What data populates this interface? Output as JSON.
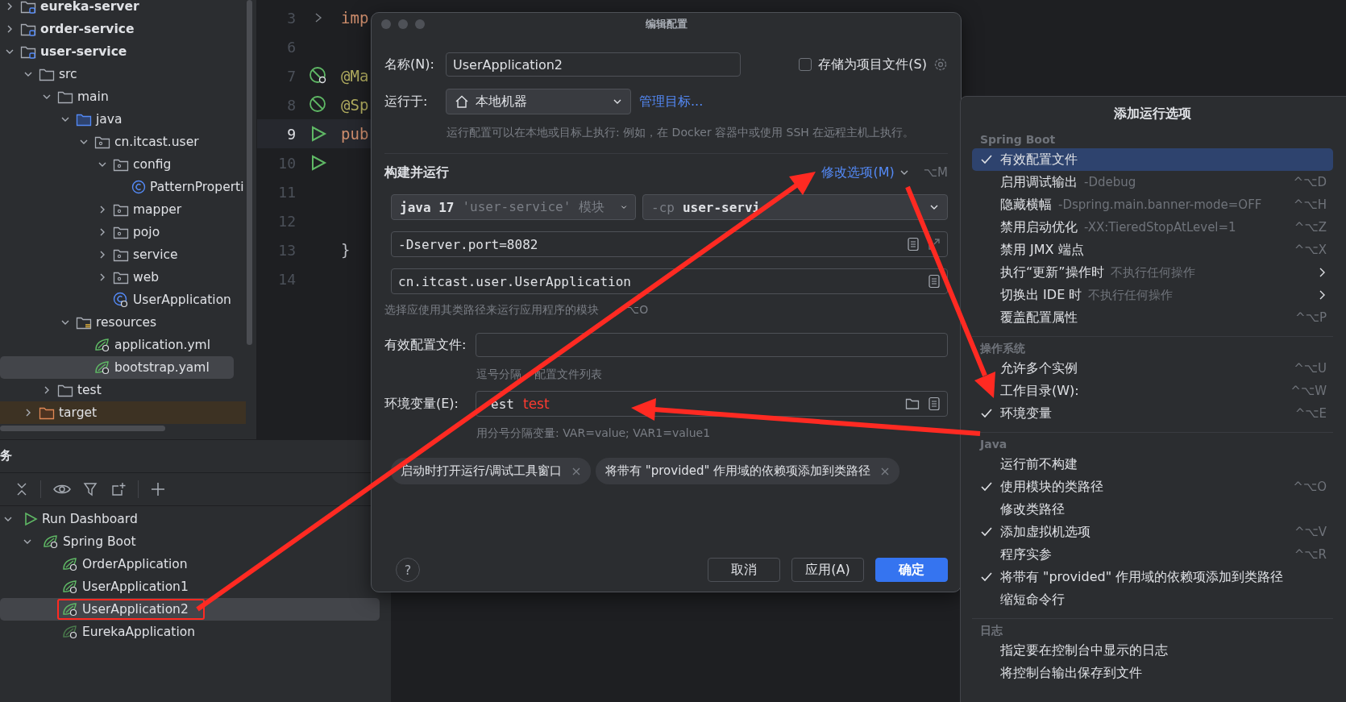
{
  "project_tree": {
    "items": [
      {
        "label": "eureka-server",
        "kind": "module",
        "expanded": false,
        "selected": false
      },
      {
        "label": "order-service",
        "kind": "module",
        "expanded": false,
        "selected": false
      },
      {
        "label": "user-service",
        "kind": "module",
        "expanded": true,
        "selected": false,
        "children": [
          {
            "label": "src",
            "kind": "folder",
            "expanded": true,
            "selected": false,
            "children": [
              {
                "label": "main",
                "kind": "folder",
                "expanded": true,
                "selected": false,
                "children": [
                  {
                    "label": "java",
                    "kind": "source-folder",
                    "expanded": true,
                    "selected": false,
                    "children": [
                      {
                        "label": "cn.itcast.user",
                        "kind": "package",
                        "expanded": true,
                        "selected": false,
                        "children": [
                          {
                            "label": "config",
                            "kind": "package",
                            "expanded": true,
                            "selected": false,
                            "children": [
                              {
                                "label": "PatternProperti",
                                "kind": "class",
                                "selected": false
                              }
                            ]
                          },
                          {
                            "label": "mapper",
                            "kind": "package",
                            "expanded": false,
                            "selected": false
                          },
                          {
                            "label": "pojo",
                            "kind": "package",
                            "expanded": false,
                            "selected": false
                          },
                          {
                            "label": "service",
                            "kind": "package",
                            "expanded": false,
                            "selected": false
                          },
                          {
                            "label": "web",
                            "kind": "package",
                            "expanded": false,
                            "selected": false
                          },
                          {
                            "label": "UserApplication",
                            "kind": "spring-class",
                            "selected": false
                          }
                        ]
                      }
                    ]
                  },
                  {
                    "label": "resources",
                    "kind": "resources-folder",
                    "expanded": true,
                    "selected": false,
                    "children": [
                      {
                        "label": "application.yml",
                        "kind": "spring-config",
                        "selected": false
                      },
                      {
                        "label": "bootstrap.yaml",
                        "kind": "spring-config",
                        "selected": true
                      }
                    ]
                  }
                ]
              },
              {
                "label": "test",
                "kind": "folder",
                "expanded": false,
                "selected": false
              }
            ]
          },
          {
            "label": "target",
            "kind": "excluded-folder",
            "expanded": false,
            "selected": false
          }
        ]
      }
    ]
  },
  "editor": {
    "lines": [
      {
        "number": "3",
        "code": "imp",
        "kind": "fold",
        "current": false
      },
      {
        "number": "6",
        "kind": "plain",
        "current": false
      },
      {
        "number": "7",
        "code": "@Ma",
        "kind": "bean-search",
        "current": false
      },
      {
        "number": "8",
        "code": "@Sp",
        "kind": "bean",
        "current": false
      },
      {
        "number": "9",
        "code": "pub",
        "kind": "run",
        "current": true
      },
      {
        "number": "10",
        "kind": "run",
        "current": false
      },
      {
        "number": "11",
        "kind": "plain",
        "current": false
      },
      {
        "number": "12",
        "kind": "plain",
        "current": false
      },
      {
        "number": "13",
        "code": "}",
        "kind": "plain",
        "current": false
      },
      {
        "number": "14",
        "kind": "plain",
        "current": false
      }
    ]
  },
  "services": {
    "title": "务",
    "items": [
      {
        "label": "Run Dashboard",
        "kind": "dashboard",
        "expanded": true,
        "selected": false,
        "annotated": false,
        "children": [
          {
            "label": "Spring Boot",
            "kind": "spring-group",
            "expanded": true,
            "selected": false,
            "annotated": false,
            "children": [
              {
                "label": "OrderApplication",
                "kind": "app",
                "selected": false,
                "annotated": false
              },
              {
                "label": "UserApplication1",
                "kind": "app",
                "selected": false,
                "annotated": false
              },
              {
                "label": "UserApplication2",
                "kind": "app",
                "selected": true,
                "annotated": true
              },
              {
                "label": "EurekaApplication",
                "kind": "app",
                "selected": false,
                "annotated": false
              }
            ]
          }
        ]
      }
    ]
  },
  "dialog": {
    "title": "编辑配置",
    "name_label": "名称(N):",
    "name_value": "UserApplication2",
    "store_as_file": {
      "label": "存储为项目文件(S)",
      "checked": false
    },
    "run_on_label": "运行于:",
    "run_on_value": "本地机器",
    "manage_targets": "管理目标...",
    "run_on_hint": "运行配置可以在本地或目标上执行: 例如，在 Docker 容器中或使用 SSH 在远程主机上执行。",
    "section_title": "构建并运行",
    "modify_options": "修改选项(M)",
    "modify_shortcut": "⌥M",
    "jdk": {
      "value": "java 17",
      "hint": "'user-service' 模块"
    },
    "classpath": {
      "prefix": "-cp",
      "value": "user-servi"
    },
    "vm_options": "-Dserver.port=8082",
    "main_class": "cn.itcast.user.UserApplication",
    "module_hint": "选择应使用其类路径来运行应用程序的模块",
    "module_shortcut": "⌥O",
    "profiles_label": "有效配置文件:",
    "profiles_hint": [
      "逗号分隔",
      "配置文件列表"
    ],
    "env_label": "环境变量(E):",
    "env_value": "est",
    "env_annotation": "test",
    "env_hint": "用分号分隔变量: VAR=value; VAR1=value1",
    "chips": [
      "启动时打开运行/调试工具窗口",
      "将带有 \"provided\" 作用域的依赖项添加到类路径"
    ],
    "help": "?",
    "buttons": [
      {
        "label": "取消",
        "primary": false
      },
      {
        "label": "应用(A)",
        "primary": false
      },
      {
        "label": "确定",
        "primary": true
      }
    ]
  },
  "popup": {
    "title": "添加运行选项",
    "groups": [
      {
        "title": "Spring Boot",
        "items": [
          {
            "label": "有效配置文件",
            "checked": true,
            "selected": true,
            "submenu": false
          },
          {
            "label": "启用调试输出",
            "hint": "-Ddebug",
            "shortcut": "^⌥D",
            "checked": false,
            "selected": false,
            "submenu": false
          },
          {
            "label": "隐藏横幅",
            "hint": "-Dspring.main.banner-mode=OFF",
            "shortcut": "^⌥H",
            "checked": false,
            "selected": false,
            "submenu": false
          },
          {
            "label": "禁用启动优化",
            "hint": "-XX:TieredStopAtLevel=1",
            "shortcut": "^⌥Z",
            "checked": false,
            "selected": false,
            "submenu": false
          },
          {
            "label": "禁用 JMX 端点",
            "shortcut": "^⌥X",
            "checked": false,
            "selected": false,
            "submenu": false
          },
          {
            "label": "执行“更新”操作时",
            "hint": "不执行任何操作",
            "checked": false,
            "selected": false,
            "submenu": true
          },
          {
            "label": "切换出 IDE 时",
            "hint": "不执行任何操作",
            "checked": false,
            "selected": false,
            "submenu": true
          },
          {
            "label": "覆盖配置属性",
            "shortcut": "^⌥P",
            "checked": false,
            "selected": false,
            "submenu": false
          }
        ]
      },
      {
        "title": "操作系统",
        "items": [
          {
            "label": "允许多个实例",
            "shortcut": "^⌥U",
            "checked": false,
            "selected": false,
            "submenu": false
          },
          {
            "label": "工作目录(W):",
            "shortcut": "^⌥W",
            "checked": false,
            "selected": false,
            "submenu": false
          },
          {
            "label": "环境变量",
            "shortcut": "^⌥E",
            "checked": true,
            "selected": false,
            "submenu": false
          }
        ]
      },
      {
        "title": "Java",
        "items": [
          {
            "label": "运行前不构建",
            "checked": false,
            "selected": false,
            "submenu": false
          },
          {
            "label": "使用模块的类路径",
            "shortcut": "^⌥O",
            "checked": true,
            "selected": false,
            "submenu": false
          },
          {
            "label": "修改类路径",
            "checked": false,
            "selected": false,
            "submenu": false
          },
          {
            "label": "添加虚拟机选项",
            "shortcut": "^⌥V",
            "checked": true,
            "selected": false,
            "submenu": false
          },
          {
            "label": "程序实参",
            "shortcut": "^⌥R",
            "checked": false,
            "selected": false,
            "submenu": false
          },
          {
            "label": "将带有 \"provided\" 作用域的依赖项添加到类路径",
            "checked": true,
            "selected": false,
            "submenu": false
          },
          {
            "label": "缩短命令行",
            "checked": false,
            "selected": false,
            "submenu": false
          }
        ]
      },
      {
        "title": "日志",
        "items": [
          {
            "label": "指定要在控制台中显示的日志",
            "checked": false,
            "selected": false,
            "submenu": false
          },
          {
            "label": "将控制台输出保存到文件",
            "checked": false,
            "selected": false,
            "submenu": false
          }
        ]
      }
    ]
  }
}
